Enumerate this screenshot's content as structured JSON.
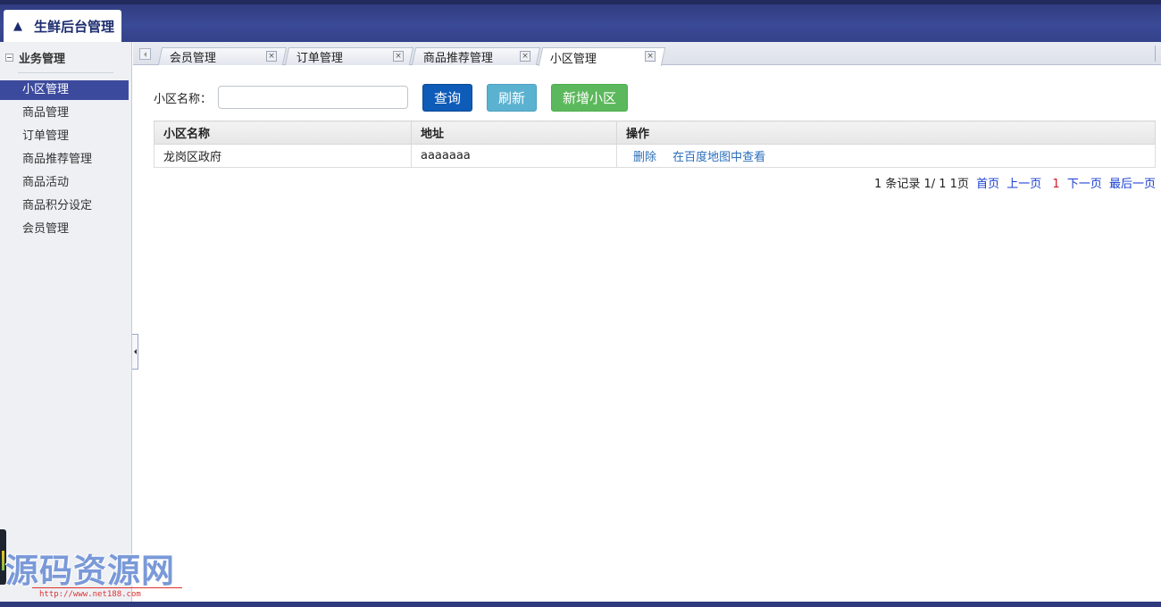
{
  "header": {
    "app_title": "生鲜后台管理",
    "home_icon": "home-icon"
  },
  "sidebar": {
    "section_title": "业务管理",
    "items": [
      {
        "label": "小区管理",
        "active": true
      },
      {
        "label": "商品管理"
      },
      {
        "label": "订单管理"
      },
      {
        "label": "商品推荐管理"
      },
      {
        "label": "商品活动"
      },
      {
        "label": "商品积分设定"
      },
      {
        "label": "会员管理"
      }
    ]
  },
  "tabs": [
    {
      "label": "会员管理"
    },
    {
      "label": "订单管理"
    },
    {
      "label": "商品推荐管理"
    },
    {
      "label": "小区管理",
      "active": true
    }
  ],
  "search": {
    "label": "小区名称：",
    "value": "",
    "query_button": "查询",
    "refresh_button": "刷新",
    "add_button": "新增小区"
  },
  "table": {
    "columns": [
      "小区名称",
      "地址",
      "操作"
    ],
    "rows": [
      {
        "name": "龙岗区政府",
        "address": "aaaaaaa",
        "ops": [
          "删除",
          "在百度地图中查看"
        ]
      }
    ]
  },
  "pager": {
    "summary": "1 条记录 1/ 1 1页",
    "first": "首页",
    "prev": "上一页",
    "current": "1",
    "next": "下一页",
    "last": "最后一页"
  },
  "watermark": {
    "text": "源码资源网",
    "url": "http://www.net188.com"
  },
  "colors": {
    "header_bg": "#3b4a96",
    "active_item": "#3c4a9e",
    "query_btn": "#0e5bb8",
    "refresh_btn": "#5bb2d0",
    "add_btn": "#5cb85c",
    "link": "#2a6ebb"
  }
}
